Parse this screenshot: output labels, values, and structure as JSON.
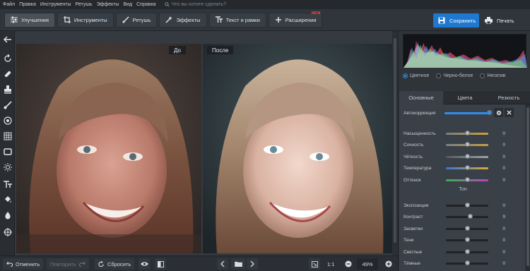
{
  "menu": {
    "items": [
      "Файл",
      "Правка",
      "Инструменты",
      "Ретушь",
      "Эффекты",
      "Вид",
      "Справка"
    ],
    "search_placeholder": "Что вы хотите сделать?"
  },
  "toolbar": {
    "tabs": [
      {
        "label": "Улучшения",
        "icon": "sliders-icon",
        "active": true
      },
      {
        "label": "Инструменты",
        "icon": "crop-icon",
        "active": false
      },
      {
        "label": "Ретушь",
        "icon": "brush-icon",
        "active": false
      },
      {
        "label": "Эффекты",
        "icon": "magic-wand-icon",
        "active": false
      },
      {
        "label": "Текст и рамки",
        "icon": "text-icon",
        "active": false
      },
      {
        "label": "Расширения",
        "icon": "plus-icon",
        "active": false,
        "badge": "NEW"
      }
    ],
    "save_label": "Сохранить",
    "print_label": "Печать"
  },
  "canvas": {
    "before_label": "До",
    "after_label": "После"
  },
  "left_tools": [
    "back-arrow-icon",
    "rotate-icon",
    "bandage-icon",
    "stamp-icon",
    "brush-icon",
    "target-icon",
    "grid-icon",
    "frame-icon",
    "sun-icon",
    "text-icon",
    "bucket-icon",
    "drop-icon",
    "crosshair-icon"
  ],
  "right_panel": {
    "modes": [
      {
        "label": "Цветное",
        "selected": true
      },
      {
        "label": "Черно-белое",
        "selected": false
      },
      {
        "label": "Негатив",
        "selected": false
      }
    ],
    "tabs": [
      {
        "label": "Основные",
        "active": true
      },
      {
        "label": "Цвета",
        "active": false
      },
      {
        "label": "Резкость",
        "active": false
      }
    ],
    "autocorrection_label": "Автокоррекция",
    "sliders": [
      {
        "label": "Насыщенность",
        "value": "0",
        "pos": 0.5
      },
      {
        "label": "Сочность",
        "value": "0",
        "pos": 0.5
      },
      {
        "label": "Чёткость",
        "value": "0",
        "pos": 0.5
      },
      {
        "label": "Температура",
        "value": "0",
        "pos": 0.5
      },
      {
        "label": "Оттенок",
        "value": "0",
        "pos": 0.5
      }
    ],
    "ton_label": "Тон",
    "tone_sliders": [
      {
        "label": "Экспозиция",
        "value": "0",
        "pos": 0.5
      },
      {
        "label": "Контраст",
        "value": "9",
        "pos": 0.58
      },
      {
        "label": "Засветки",
        "value": "0",
        "pos": 0.5
      },
      {
        "label": "Тени",
        "value": "0",
        "pos": 0.5
      },
      {
        "label": "Светлые",
        "value": "0",
        "pos": 0.5
      },
      {
        "label": "Тёмные",
        "value": "0",
        "pos": 0.5
      }
    ]
  },
  "bottom": {
    "undo_label": "Отменить",
    "redo_label": "Повторить",
    "reset_label": "Сбросить",
    "zoom_1to1": "1:1",
    "zoom_value": "49%"
  },
  "colors": {
    "accent": "#1e78d0",
    "new_badge": "#ff4a3d"
  }
}
